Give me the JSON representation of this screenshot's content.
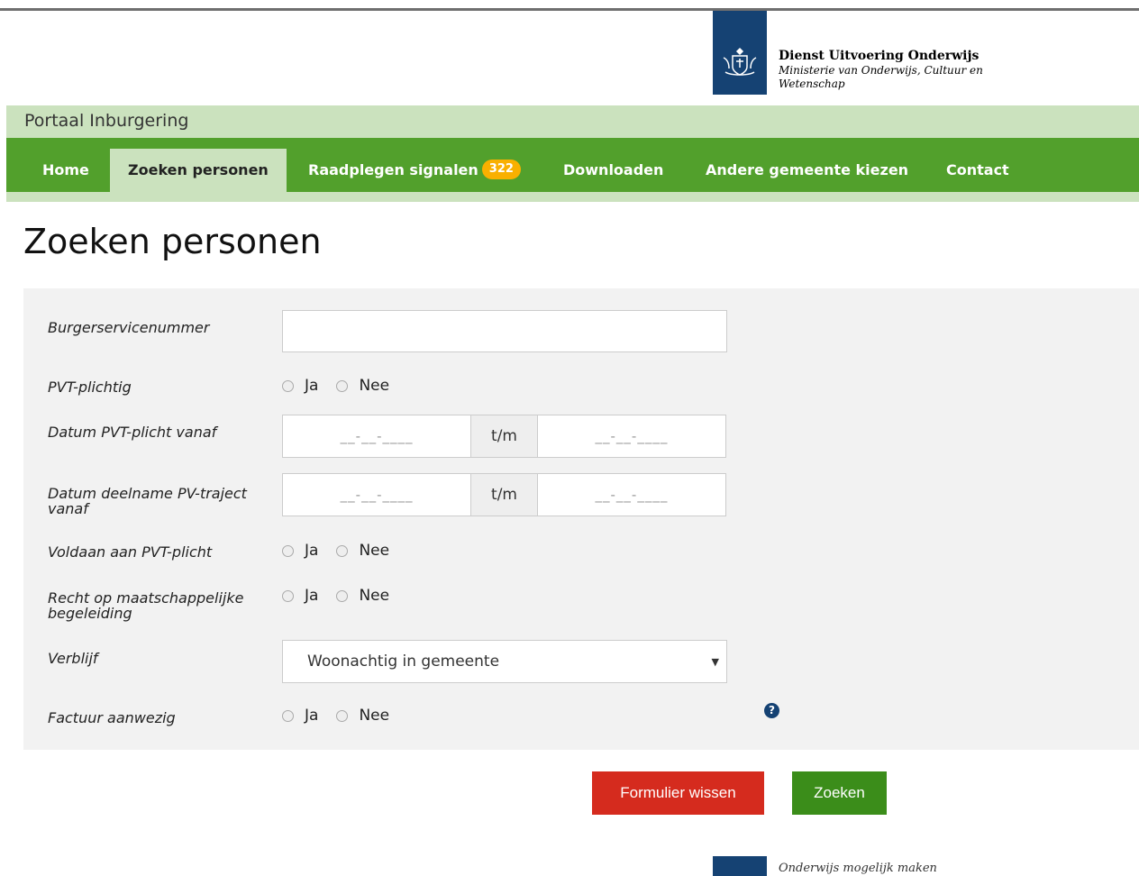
{
  "header": {
    "org_name": "Dienst Uitvoering Onderwijs",
    "ministry": "Ministerie van Onderwijs, Cultuur en Wetenschap",
    "logo_icon": "rijksoverheid-crest-icon",
    "brand_color": "#154273"
  },
  "portal": {
    "title": "Portaal Inburgering"
  },
  "nav": {
    "tabs": [
      {
        "label": "Home"
      },
      {
        "label": "Zoeken personen",
        "active": true
      },
      {
        "label": "Raadplegen signalen",
        "badge": "322"
      },
      {
        "label": "Downloaden"
      },
      {
        "label": "Andere gemeente kiezen"
      },
      {
        "label": "Contact"
      }
    ],
    "color": "#52a02c"
  },
  "page": {
    "title": "Zoeken personen"
  },
  "form": {
    "bsn": {
      "label": "Burgerservicenummer",
      "value": ""
    },
    "pvt_plichtig": {
      "label": "PVT-plichtig",
      "yes": "Ja",
      "no": "Nee"
    },
    "datum_pvt": {
      "label": "Datum PVT-plicht vanaf",
      "from_placeholder": "__-__-____",
      "sep": "t/m",
      "to_placeholder": "__-__-____"
    },
    "datum_deelname": {
      "label": "Datum deelname PV-traject vanaf",
      "from_placeholder": "__-__-____",
      "sep": "t/m",
      "to_placeholder": "__-__-____"
    },
    "voldaan": {
      "label": "Voldaan aan PVT-plicht",
      "yes": "Ja",
      "no": "Nee"
    },
    "recht": {
      "label": "Recht op maatschappelijke begeleiding",
      "yes": "Ja",
      "no": "Nee"
    },
    "verblijf": {
      "label": "Verblijf",
      "selected": "Woonachtig in gemeente"
    },
    "factuur": {
      "label": "Factuur aanwezig",
      "yes": "Ja",
      "no": "Nee",
      "help_icon": "question-circle-icon"
    }
  },
  "actions": {
    "clear_label": "Formulier wissen",
    "clear_color": "#d52b1e",
    "search_label": "Zoeken",
    "search_color": "#3b8d1a"
  },
  "footer": {
    "tagline": "Onderwijs mogelijk maken"
  }
}
